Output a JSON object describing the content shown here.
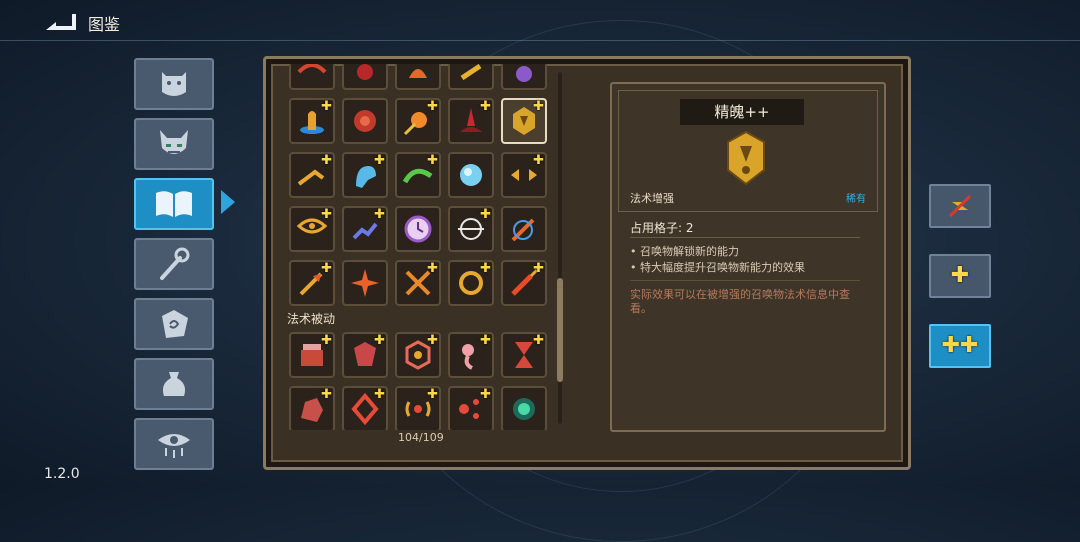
{
  "header": {
    "title": "图鉴",
    "back_icon": "back-arrow-icon"
  },
  "version": "1.2.0",
  "side_tabs": [
    {
      "icon": "face-icon",
      "active": false
    },
    {
      "icon": "demon-icon",
      "active": false
    },
    {
      "icon": "book-icon",
      "active": true
    },
    {
      "icon": "staff-icon",
      "active": false
    },
    {
      "icon": "rune-stone-icon",
      "active": false
    },
    {
      "icon": "pouch-icon",
      "active": false
    },
    {
      "icon": "eye-icon",
      "active": false
    }
  ],
  "grid": {
    "rows": [
      [
        "fire-skill-icon",
        "blood-skill-icon",
        "flame-skill-icon",
        "gold-skill-icon",
        "purple-skill-icon"
      ],
      [
        "water-totem-icon",
        "red-orb-icon",
        "fire-burst-icon",
        "blood-spike-icon",
        "rune-shield-icon"
      ],
      [
        "gold-dash-icon",
        "ghost-icon",
        "green-arc-icon",
        "pearl-icon",
        "split-arrow-icon"
      ],
      [
        "gold-eye-icon",
        "chain-icon",
        "clock-icon",
        "target-icon",
        "orbit-arrow-icon"
      ],
      [
        "gold-arrow-icon",
        "red-star-icon",
        "crossed-swords-icon",
        "gold-ring-icon",
        "fire-arrow-icon"
      ]
    ],
    "passive_label": "法术被动",
    "passive_rows": [
      [
        "red-chest-icon",
        "red-gem-icon",
        "hex-shield-icon",
        "worm-icon",
        "hourglass-icon"
      ],
      [
        "red-rock-icon",
        "diamond-icon",
        "signal-icon",
        "triple-shot-icon",
        "green-portal-icon"
      ]
    ],
    "selected": "rune-shield-icon",
    "count": "104/109",
    "plus_glyph": "✚"
  },
  "detail": {
    "name": "精魄++",
    "icon": "rune-shield-icon",
    "type": "法术增强",
    "rarity": "稀有",
    "slots": "占用格子: 2",
    "effects": [
      "召唤物解锁新的能力",
      "特大幅度提升召唤物新能力的效果"
    ],
    "note": "实际效果可以在被增强的召唤物法术信息中查看。"
  },
  "right_buttons": [
    {
      "icon": "no-upgrade-icon",
      "label": "",
      "active": false
    },
    {
      "icon": "single-plus-icon",
      "label": "✚",
      "active": false
    },
    {
      "icon": "double-plus-icon",
      "label": "✚✚",
      "active": true
    }
  ],
  "colors": {
    "accent": "#1e8fc4",
    "gold": "#ffd84a",
    "rarity": "#2fb0e8",
    "note": "#b77a5a"
  }
}
